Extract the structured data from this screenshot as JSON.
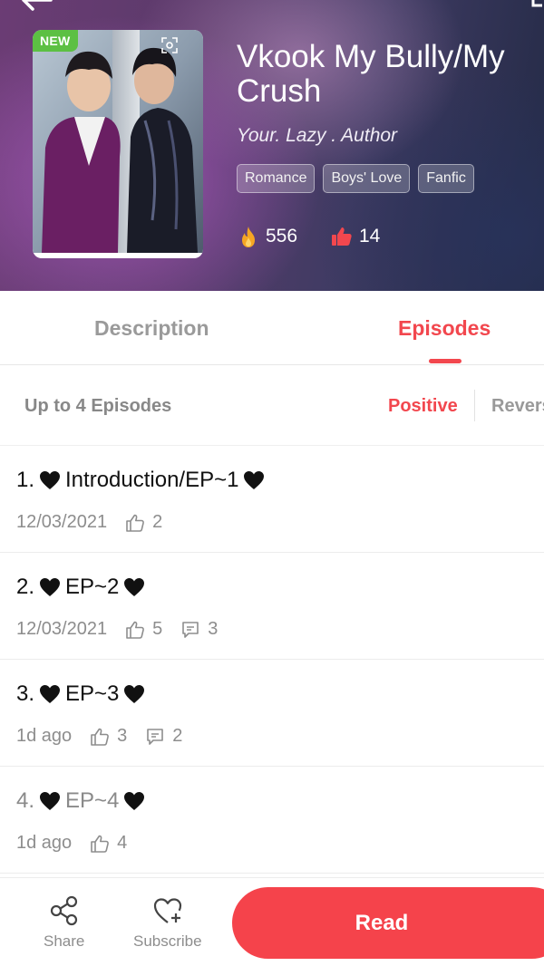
{
  "header": {
    "badge": "NEW",
    "title": "Vkook My Bully/My Crush",
    "author": "Your. Lazy . Author",
    "tags": [
      "Romance",
      "Boys' Love",
      "Fanfic"
    ],
    "views": "556",
    "likes": "14",
    "icons": {
      "back": "back-arrow-icon",
      "views": "fire-icon",
      "likes": "thumbs-up-icon"
    },
    "colors": {
      "accent": "#f2474e",
      "badge": "#5cc043"
    }
  },
  "tabs": [
    {
      "label": "Description",
      "active": false
    },
    {
      "label": "Episodes",
      "active": true
    }
  ],
  "episode_bar": {
    "count_label": "Up to 4 Episodes",
    "sort_positive": "Positive",
    "sort_reverse": "Reverse"
  },
  "episodes": [
    {
      "num": "1.",
      "name": "Introduction/EP~1",
      "date": "12/03/2021",
      "likes": "2",
      "comments": ""
    },
    {
      "num": "2.",
      "name": "EP~2",
      "date": "12/03/2021",
      "likes": "5",
      "comments": "3"
    },
    {
      "num": "3.",
      "name": "EP~3",
      "date": "1d ago",
      "likes": "3",
      "comments": "2"
    },
    {
      "num": "4.",
      "name": "EP~4",
      "date": "1d ago",
      "likes": "4",
      "comments": ""
    }
  ],
  "bottom_bar": {
    "share_label": "Share",
    "subscribe_label": "Subscribe",
    "read_label": "Read"
  }
}
